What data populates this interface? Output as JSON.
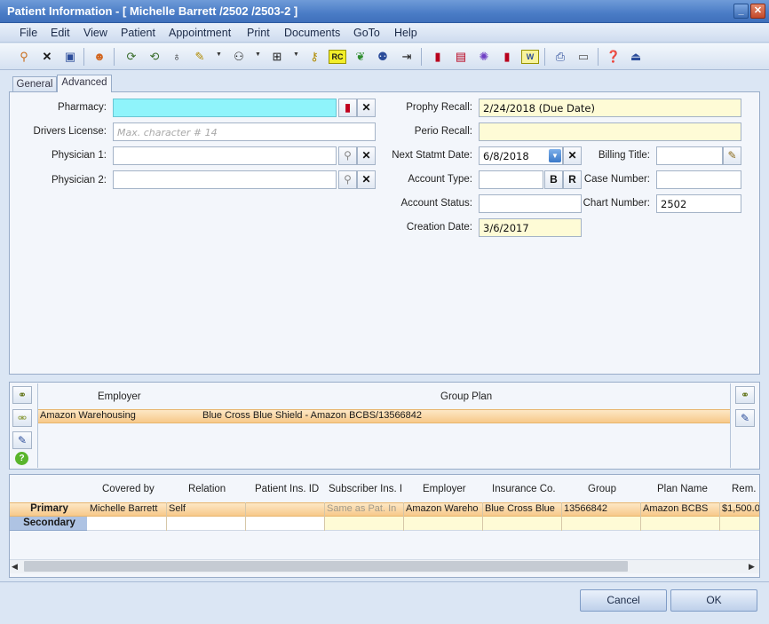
{
  "window": {
    "title": "Patient Information - [ Michelle Barrett /2502 /2503-2 ]",
    "minimize": "_",
    "close": "✕"
  },
  "menu": [
    "File",
    "Edit",
    "View",
    "Patient",
    "Appointment",
    "Print",
    "Documents",
    "GoTo",
    "Help"
  ],
  "toolbar": {
    "icons": [
      "find-patient-icon",
      "delete-icon",
      "save-icon",
      "person-icon",
      "sync-icon",
      "sync-all-icon",
      "tooth-icon",
      "note-icon",
      "tree-icon",
      "grid-icon",
      "key-icon",
      "rc-icon",
      "molar-icon",
      "family-icon",
      "export-icon",
      "book-red-icon",
      "docs-red-icon",
      "wheel-icon",
      "pdf-icon",
      "word-icon",
      "scanner-icon",
      "card-icon",
      "help-icon",
      "exit-icon"
    ],
    "rc_label": "RC",
    "w_label": "W"
  },
  "tabs": {
    "general": "General",
    "advanced": "Advanced"
  },
  "form": {
    "pharmacy_label": "Pharmacy:",
    "pharmacy_value": "",
    "drivers_license_label": "Drivers License:",
    "drivers_license_placeholder": "Max. character # 14",
    "physician1_label": "Physician 1:",
    "physician1_value": "",
    "physician2_label": "Physician 2:",
    "physician2_value": "",
    "prophy_recall_label": "Prophy Recall:",
    "prophy_recall_value": "2/24/2018 (Due Date)",
    "perio_recall_label": "Perio Recall:",
    "perio_recall_value": "",
    "next_statement_label": "Next Statmt Date:",
    "next_statement_value": "6/8/2018",
    "account_type_label": "Account Type:",
    "account_type_value": "",
    "account_type_b": "B",
    "account_type_r": "R",
    "account_status_label": "Account Status:",
    "account_status_value": "",
    "creation_date_label": "Creation Date:",
    "creation_date_value": "3/6/2017",
    "billing_title_label": "Billing Title:",
    "billing_title_value": "",
    "case_number_label": "Case Number:",
    "case_number_value": "",
    "chart_number_label": "Chart Number:",
    "chart_number_value": "2502"
  },
  "employer_grid": {
    "columns": [
      "Employer",
      "Group Plan"
    ],
    "rows": [
      {
        "employer": "Amazon Warehousing",
        "group_plan": "Blue Cross Blue Shield - Amazon BCBS/13566842"
      }
    ]
  },
  "insurance_grid": {
    "columns": [
      "Covered by",
      "Relation",
      "Patient Ins. ID",
      "Subscriber Ins. I",
      "Employer",
      "Insurance Co.",
      "Group",
      "Plan Name",
      "Rem. B"
    ],
    "primary": {
      "label": "Primary",
      "covered_by": "Michelle Barrett",
      "relation": "Self",
      "patient_ins_id": "",
      "subscriber_ins_id": "Same as Pat. In",
      "employer": "Amazon Wareho",
      "insurance_co": "Blue Cross Blue",
      "group": "13566842",
      "plan_name": "Amazon BCBS",
      "rem_benefit": "$1,500.0"
    },
    "secondary": {
      "label": "Secondary"
    }
  },
  "buttons": {
    "cancel": "Cancel",
    "ok": "OK"
  },
  "colors": {
    "highlight_field": "#8ff4fb",
    "recall_field": "#fefbd6",
    "selected_row": "#fbd9a8"
  }
}
